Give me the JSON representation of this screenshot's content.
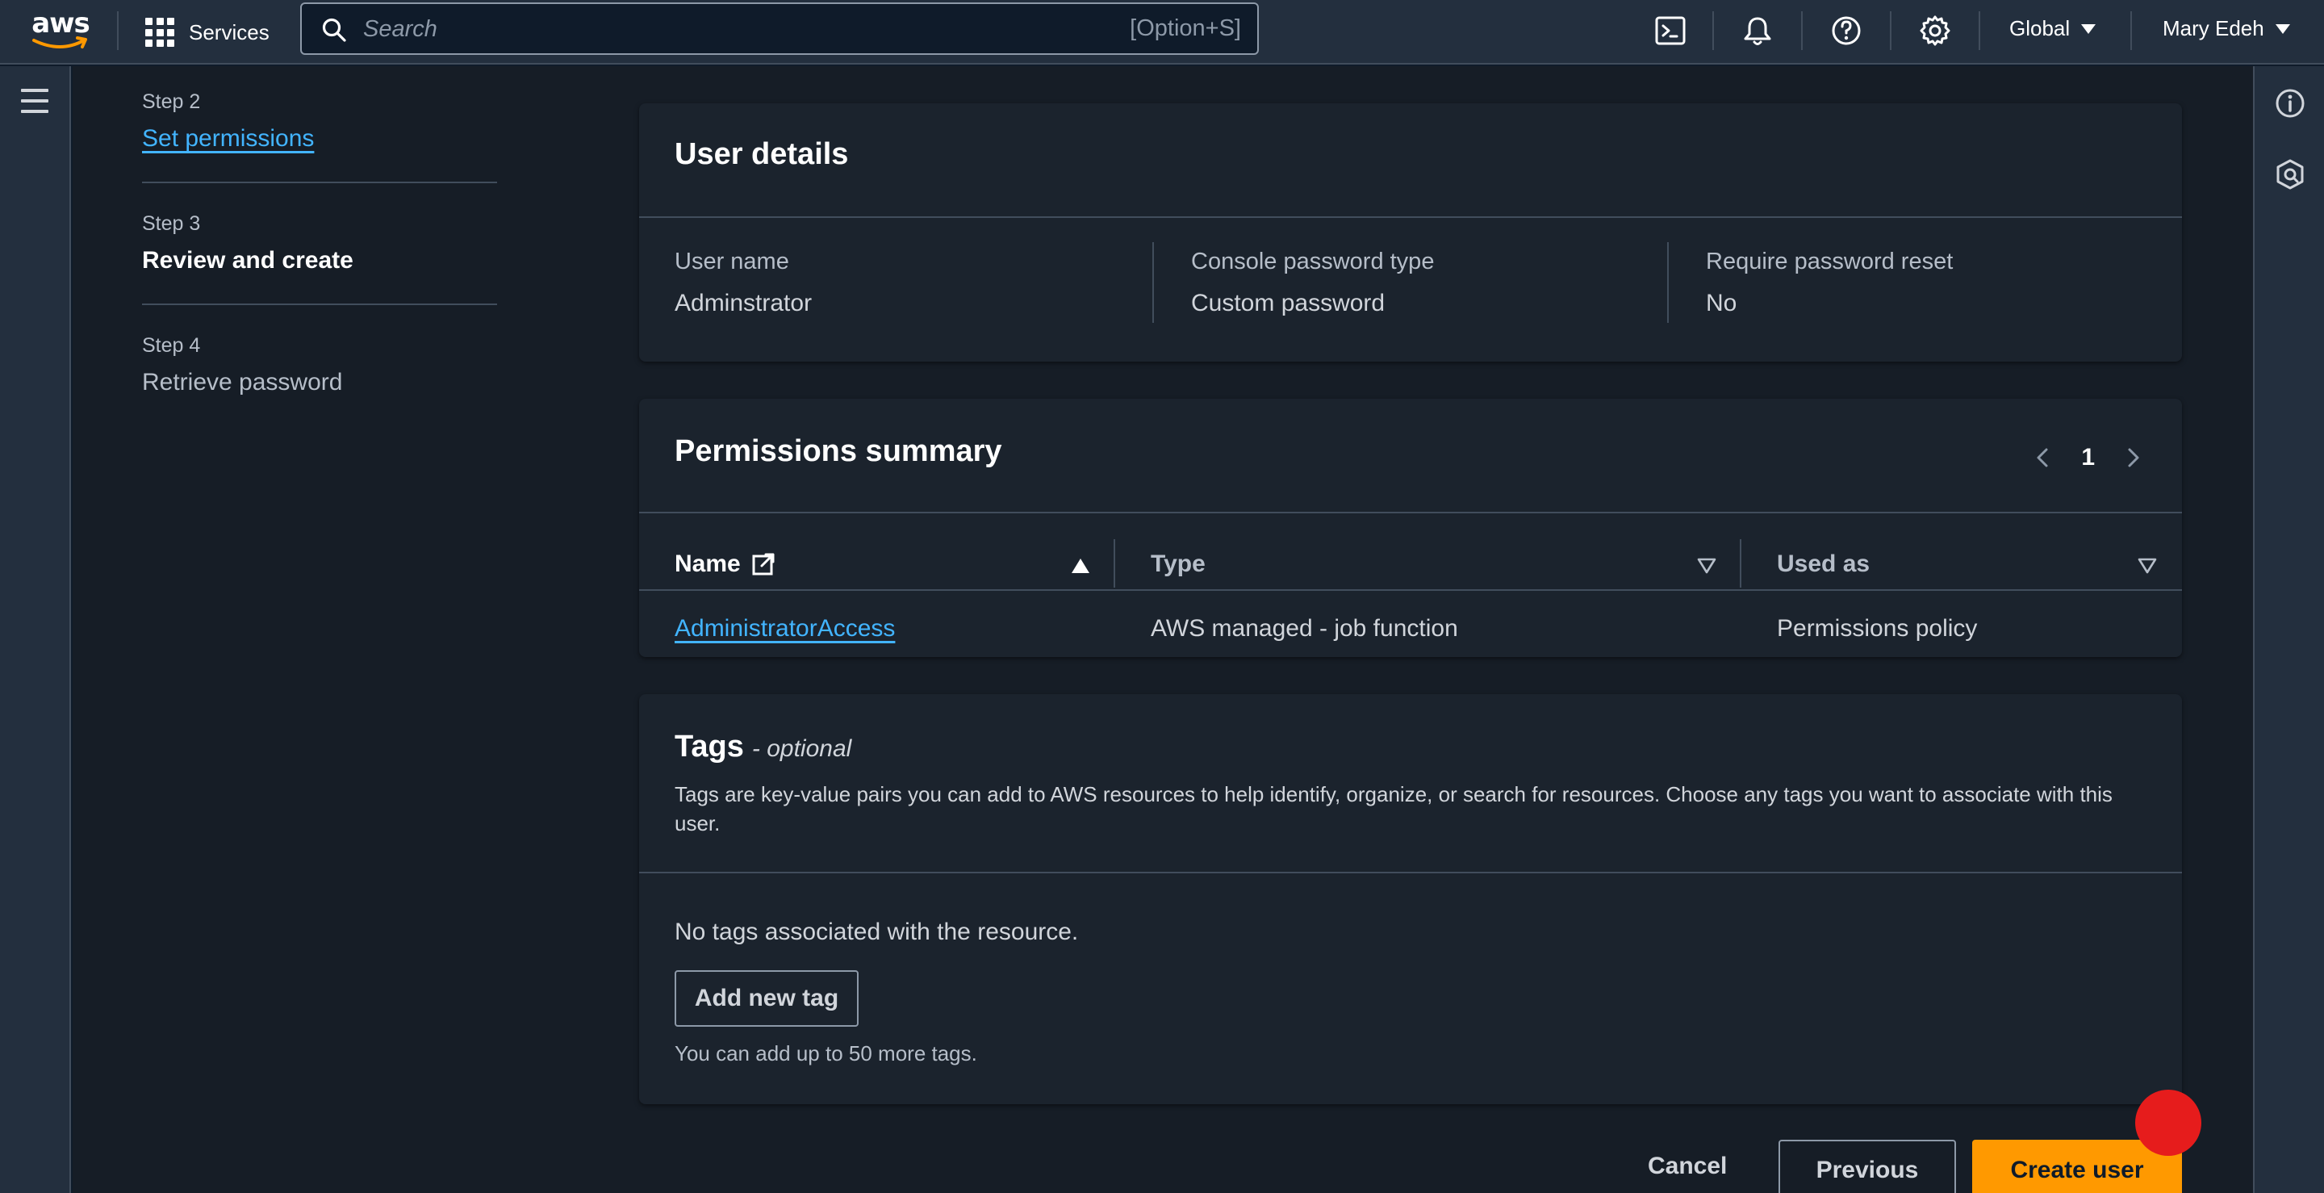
{
  "topnav": {
    "logo_text": "aws",
    "services_label": "Services",
    "search_placeholder": "Search",
    "search_shortcut": "[Option+S]",
    "region_label": "Global",
    "account_label": "Mary Edeh",
    "icons": [
      "cloudshell-icon",
      "notifications-icon",
      "help-icon",
      "settings-icon"
    ]
  },
  "steps": [
    {
      "number": "Step 2",
      "title": "Set permissions",
      "state": "link"
    },
    {
      "number": "Step 3",
      "title": "Review and create",
      "state": "current"
    },
    {
      "number": "Step 4",
      "title": "Retrieve password",
      "state": "disabled"
    }
  ],
  "user_details": {
    "heading": "User details",
    "fields": [
      {
        "label": "User name",
        "value": "Adminstrator"
      },
      {
        "label": "Console password type",
        "value": "Custom password"
      },
      {
        "label": "Require password reset",
        "value": "No"
      }
    ]
  },
  "permissions": {
    "heading": "Permissions summary",
    "page": "1",
    "columns": [
      "Name",
      "Type",
      "Used as"
    ],
    "rows": [
      {
        "name": "AdministratorAccess",
        "type": "AWS managed - job function",
        "used_as": "Permissions policy"
      }
    ]
  },
  "tags": {
    "heading": "Tags",
    "optional_label": "- optional",
    "description": "Tags are key-value pairs you can add to AWS resources to help identify, organize, or search for resources. Choose any tags you want to associate with this user.",
    "empty_message": "No tags associated with the resource.",
    "add_button": "Add new tag",
    "hint": "You can add up to 50 more tags."
  },
  "footer": {
    "cancel": "Cancel",
    "previous": "Previous",
    "create": "Create user"
  },
  "colors": {
    "accent": "#ff9900",
    "link": "#42b4ff",
    "nav_bg": "#232f3e",
    "page_bg": "#161d26",
    "panel_bg": "#1b232d",
    "cursor_marker": "#e61c1c"
  }
}
